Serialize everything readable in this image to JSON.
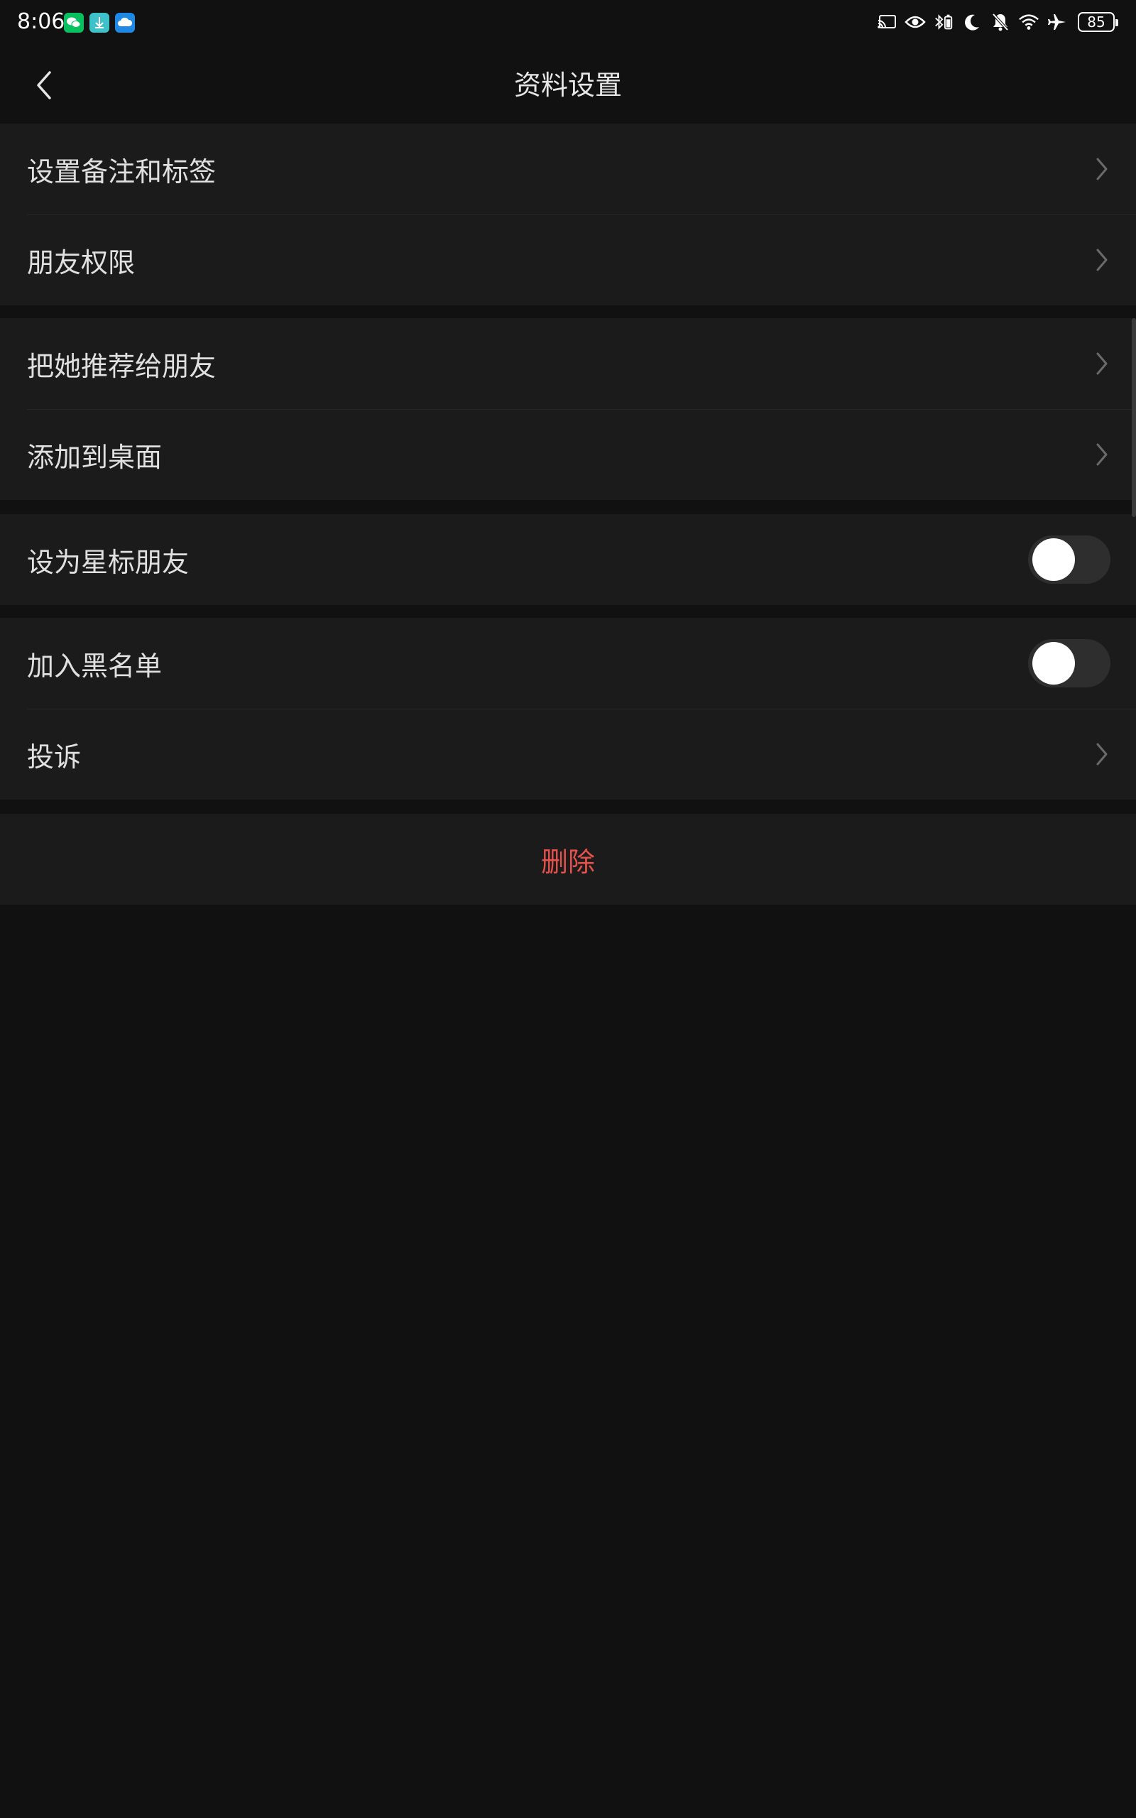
{
  "status_bar": {
    "time": "8:06",
    "battery": "85",
    "notification_apps": [
      "wechat-icon",
      "download-app-icon",
      "cloud-app-icon"
    ],
    "icons": [
      "cast-icon",
      "eye-comfort-icon",
      "bluetooth-battery-icon",
      "moon-icon",
      "mute-bell-icon",
      "wifi-icon",
      "airplane-icon"
    ]
  },
  "nav": {
    "title": "资料设置",
    "back_icon": "chevron-left-icon"
  },
  "groups": {
    "g1": [
      {
        "label": "设置备注和标签"
      },
      {
        "label": "朋友权限"
      }
    ],
    "g2": [
      {
        "label": "把她推荐给朋友"
      },
      {
        "label": "添加到桌面"
      }
    ],
    "g3": [
      {
        "label": "设为星标朋友",
        "toggle": false
      }
    ],
    "g4": [
      {
        "label": "加入黑名单",
        "toggle": false
      },
      {
        "label": "投诉"
      }
    ]
  },
  "delete": {
    "label": "删除"
  },
  "colors": {
    "background": "#111111",
    "cell": "#1b1b1b",
    "danger": "#e5514b",
    "wechat_green": "#07c160"
  }
}
